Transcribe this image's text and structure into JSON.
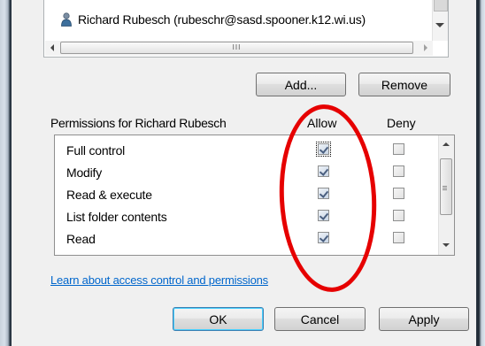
{
  "colors": {
    "annotation": "#e60000",
    "link": "#0066cc",
    "checkmark": "#4a5f80"
  },
  "user_list": {
    "selected_user": "Richard Rubesch (rubeschr@sasd.spooner.k12.wi.us)",
    "user_icon": "user-icon",
    "scroll_grip": "III"
  },
  "buttons": {
    "add": "Add...",
    "remove": "Remove",
    "ok": "OK",
    "cancel": "Cancel",
    "apply": "Apply"
  },
  "permissions": {
    "title": "Permissions for Richard Rubesch",
    "allow_header": "Allow",
    "deny_header": "Deny",
    "rows": [
      {
        "label": "Full control",
        "allow": true,
        "deny": false
      },
      {
        "label": "Modify",
        "allow": true,
        "deny": false
      },
      {
        "label": "Read & execute",
        "allow": true,
        "deny": false
      },
      {
        "label": "List folder contents",
        "allow": true,
        "deny": false
      },
      {
        "label": "Read",
        "allow": true,
        "deny": false
      }
    ]
  },
  "help_link": "Learn about access control and permissions"
}
